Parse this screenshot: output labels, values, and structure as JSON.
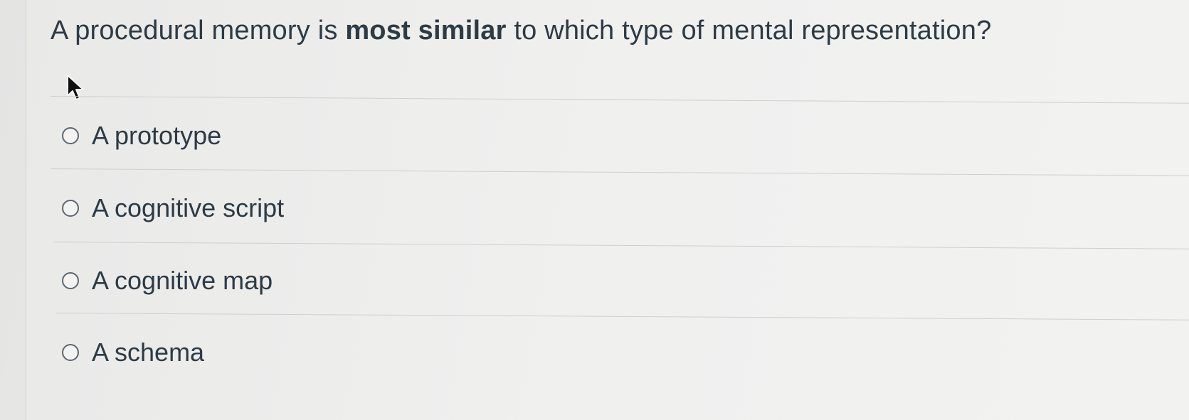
{
  "question": {
    "text_before": "A procedural memory is ",
    "text_emphasis": "most similar",
    "text_after": " to which type of mental representation?"
  },
  "answers": [
    {
      "label": "A prototype",
      "selected": false
    },
    {
      "label": "A cognitive script",
      "selected": false
    },
    {
      "label": "A cognitive map",
      "selected": false
    },
    {
      "label": "A schema",
      "selected": false
    }
  ],
  "icons": {
    "pointer": "mouse-pointer-icon",
    "radio": "radio-button-icon"
  },
  "colors": {
    "text": "#2d3b45",
    "radio_border": "#5b6770",
    "background": "#ededec"
  }
}
